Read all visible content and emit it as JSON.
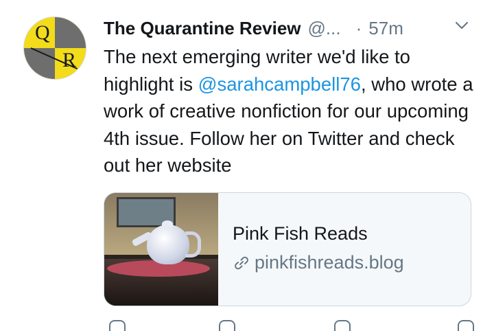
{
  "tweet": {
    "display_name": "The Quarantine Review",
    "handle": "@...",
    "separator": "·",
    "time": "57m",
    "text_before": "The next emerging writer we'd like to highlight is ",
    "mention": "@sarahcampbell76",
    "text_after": ", who wrote a work of creative nonfiction for our upcoming 4th issue. Follow her on Twitter and check out her website"
  },
  "avatar": {
    "letter_q": "Q",
    "letter_r": "R"
  },
  "card": {
    "title": "Pink Fish Reads",
    "url": "pinkfishreads.blog"
  },
  "icons": {
    "menu": "chevron-down-icon",
    "link": "link-icon",
    "reply": "reply-icon",
    "retweet": "retweet-icon",
    "like": "like-icon",
    "share": "share-icon"
  },
  "colors": {
    "mention": "#1b95e0",
    "secondary_text": "#657786",
    "avatar_yellow": "#f2dc1c",
    "avatar_gray": "#6e6e6e"
  }
}
